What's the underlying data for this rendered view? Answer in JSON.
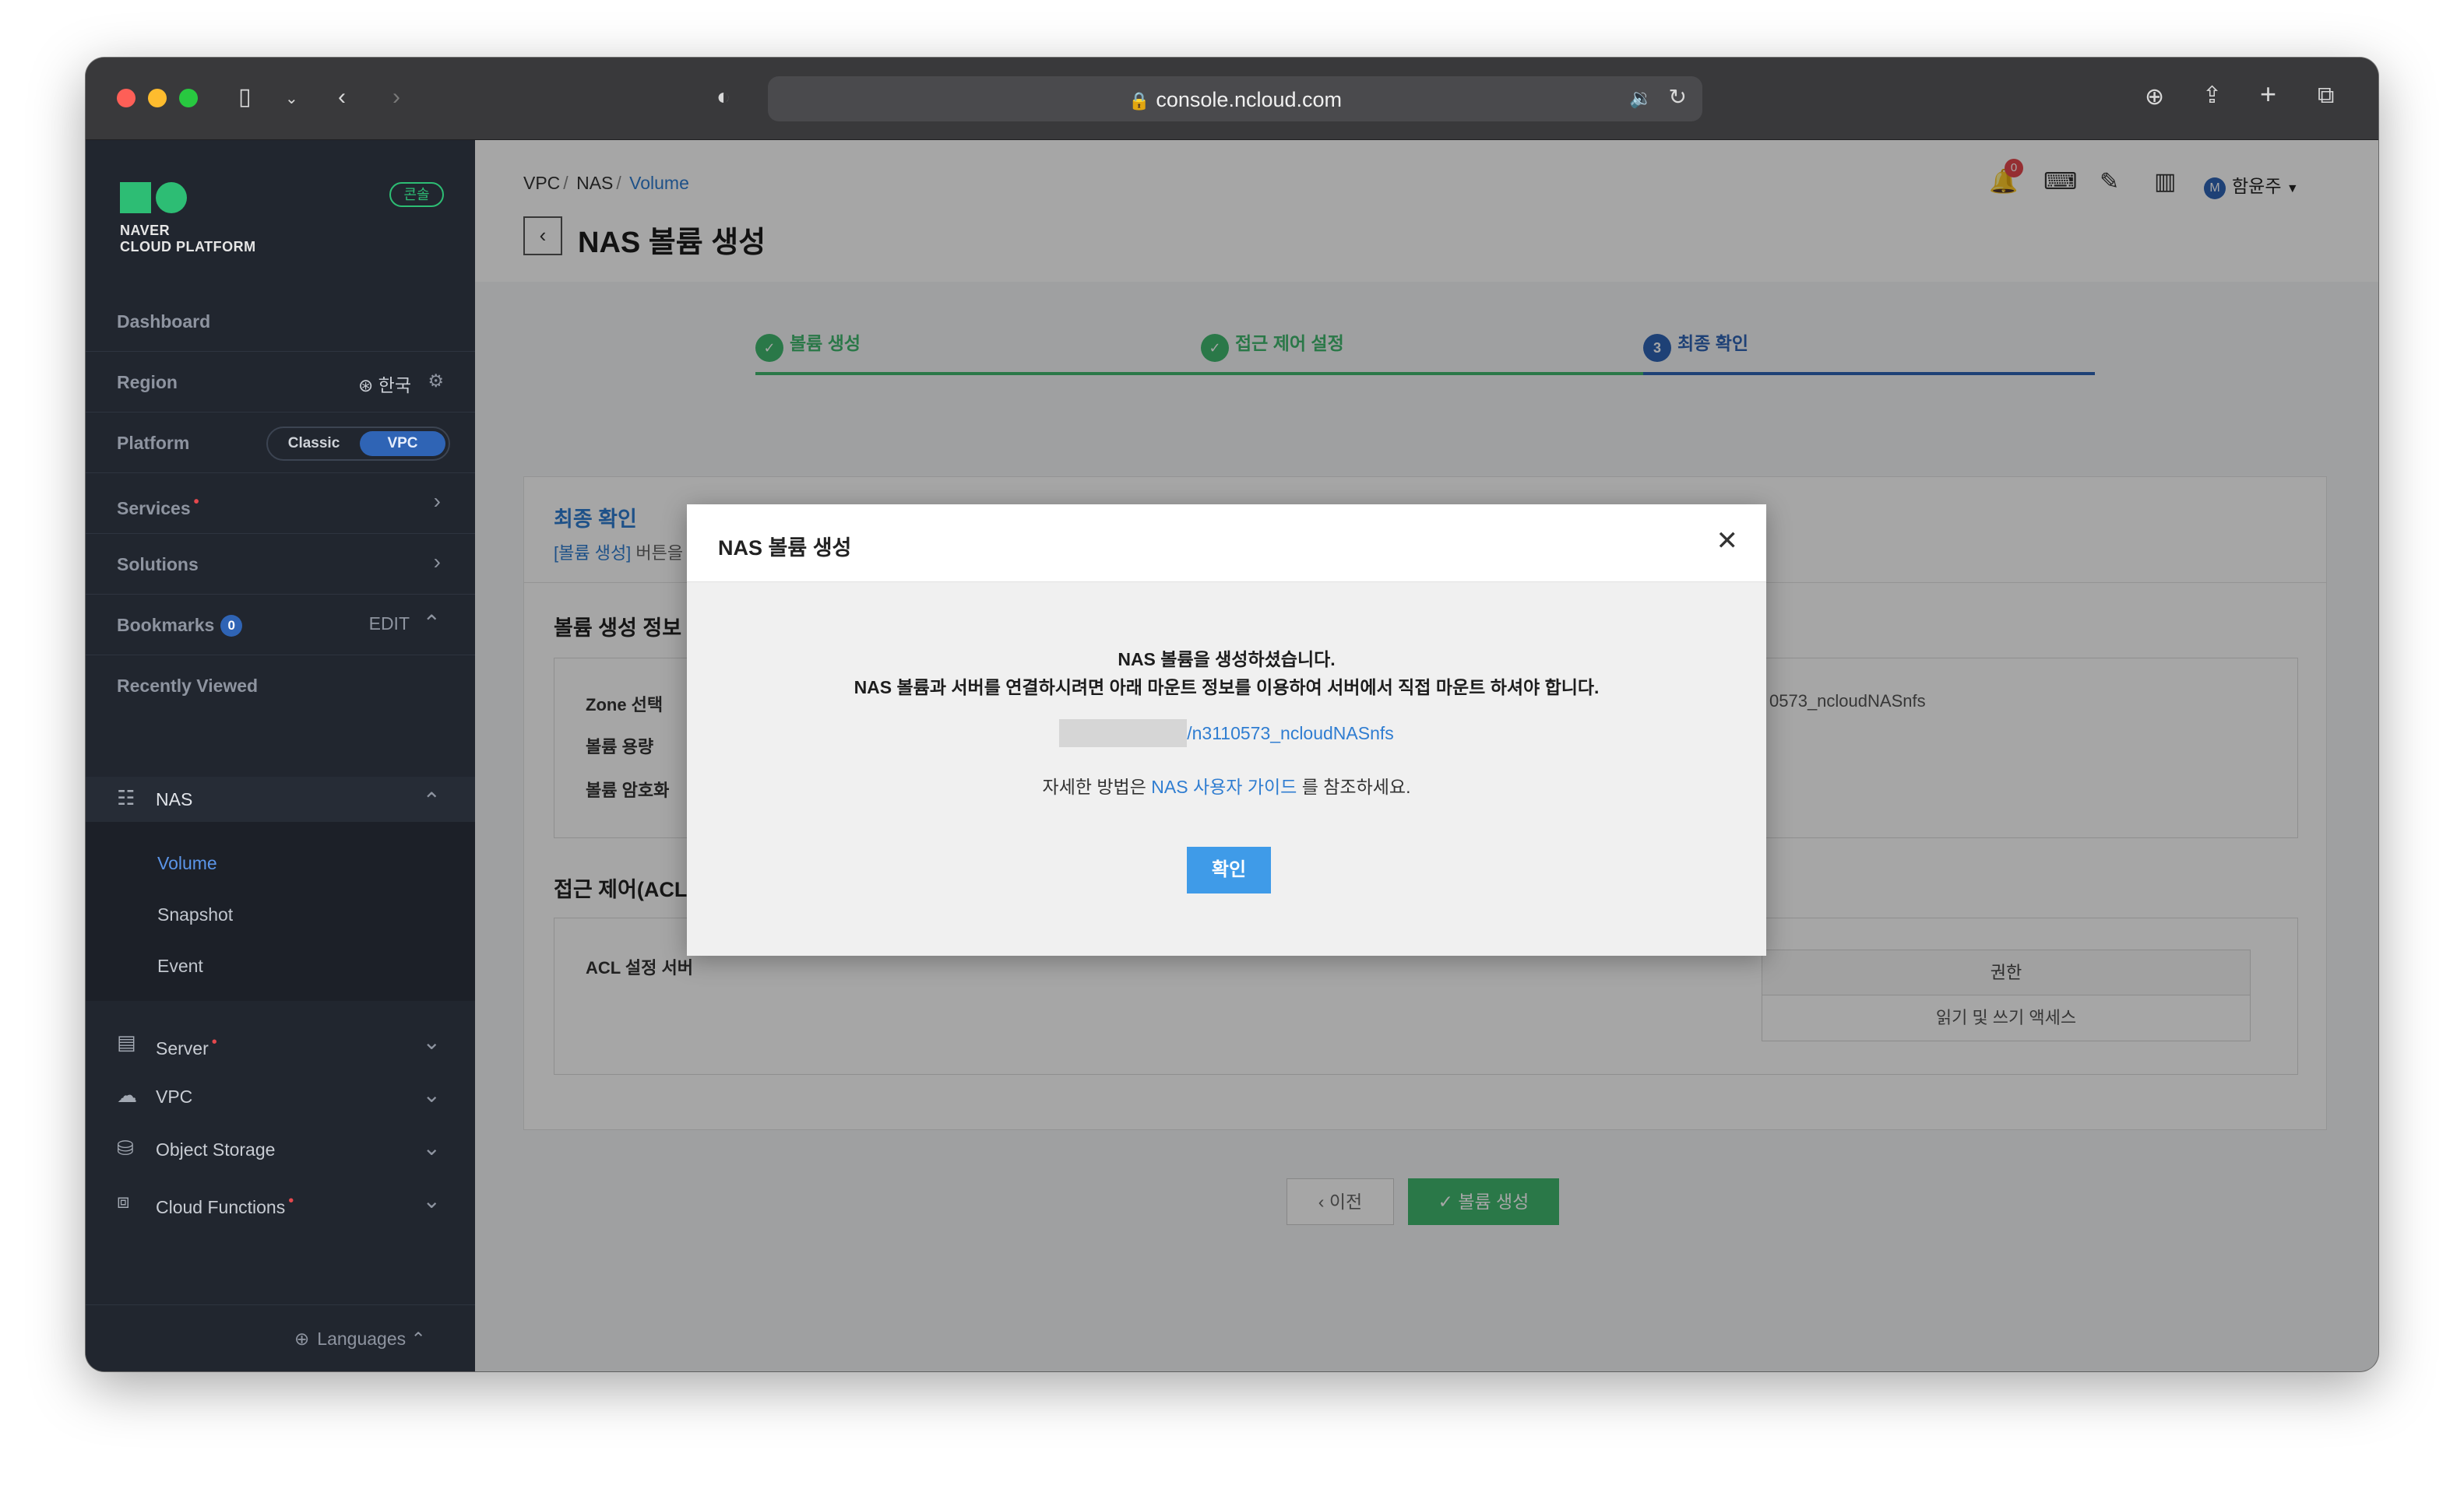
{
  "browser": {
    "url": "console.ncloud.com"
  },
  "sidebar": {
    "logo_line1": "NAVER",
    "logo_line2": "CLOUD PLATFORM",
    "console_badge": "콘솔",
    "dashboard": "Dashboard",
    "region_label": "Region",
    "region_value": "한국",
    "platform_label": "Platform",
    "platform_classic": "Classic",
    "platform_vpc": "VPC",
    "services": "Services",
    "solutions": "Solutions",
    "bookmarks": "Bookmarks",
    "bookmarks_count": "0",
    "bookmarks_edit": "EDIT",
    "recently_viewed": "Recently Viewed",
    "nas": "NAS",
    "nas_sub": [
      "Volume",
      "Snapshot",
      "Event"
    ],
    "services_list": [
      "Server",
      "VPC",
      "Object Storage",
      "Cloud Functions"
    ],
    "languages": "Languages"
  },
  "header": {
    "breadcrumb": [
      "VPC",
      "NAS",
      "Volume"
    ],
    "title": "NAS 볼륨 생성",
    "notif_count": "0",
    "user": "함윤주",
    "user_initial": "M"
  },
  "steps": [
    "볼륨 생성",
    "접근 제어 설정",
    "최종 확인"
  ],
  "step3_number": "3",
  "final": {
    "title": "최종 확인",
    "desc_highlight": "[볼륨 생성]",
    "desc_rest": " 버튼을 클릭하면 NAS 볼륨이 생성됩니다.",
    "volume_info_title": "볼륨 생성 정보",
    "labels": [
      "Zone 선택",
      "볼륨 용량",
      "볼륨 암호화"
    ],
    "mount_partial": "0573_ncloudNASnfs",
    "acl_title": "접근 제어(ACL)",
    "acl_label": "ACL 설정 서버",
    "acl_header": "권한",
    "acl_value": "읽기 및 쓰기 액세스"
  },
  "buttons": {
    "prev": "이전",
    "create": "볼륨 생성"
  },
  "modal": {
    "title": "NAS 볼륨 생성",
    "line1": "NAS 볼륨을 생성하셨습니다.",
    "line2": "NAS 볼륨과 서버를 연결하시려면 아래 마운트 정보를 이용하여 서버에서 직접 마운트 하셔야 합니다.",
    "mount_path": "/n3110573_ncloudNASnfs",
    "guide_prefix": "자세한 방법은 ",
    "guide_link": "NAS 사용자 가이드",
    "guide_suffix": " 를 참조하세요.",
    "ok": "확인"
  },
  "colors": {
    "accent_green": "#2dbd74",
    "link_blue": "#2f7dd1",
    "ok_button": "#3f9be8",
    "sidebar_bg": "#21262f"
  }
}
